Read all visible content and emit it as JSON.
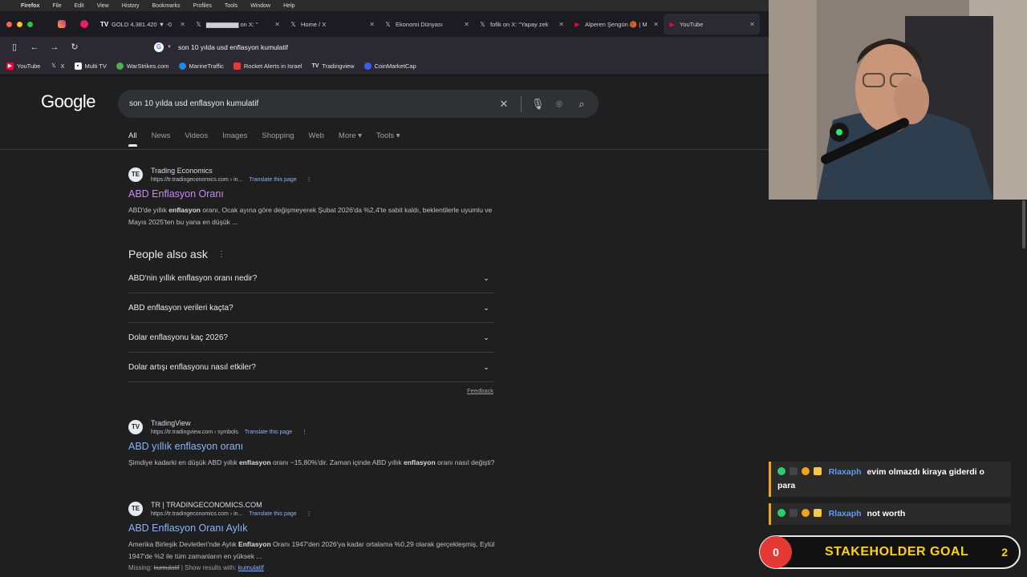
{
  "menubar": {
    "items": [
      "Firefox",
      "File",
      "Edit",
      "View",
      "History",
      "Bookmarks",
      "Profiles",
      "Tools",
      "Window",
      "Help"
    ]
  },
  "tabs": [
    {
      "label": "GOLD 4,381.420 ▼ -0",
      "icon": "tradingview-icon"
    },
    {
      "label": "▆▆▆▆▆▆▆ on X: \"",
      "icon": "x-icon"
    },
    {
      "label": "Home / X",
      "icon": "x-icon"
    },
    {
      "label": "Ekonomi Dünyası",
      "icon": "x-icon"
    },
    {
      "label": "fofik on X: \"Yapay zek",
      "icon": "x-icon"
    },
    {
      "label": "Alperen Şengün 🏀 | M",
      "icon": "youtube-icon"
    },
    {
      "label": "YouTube",
      "icon": "youtube-icon"
    }
  ],
  "address": {
    "url": "son 10 yılda usd enflasyon kumulatif"
  },
  "bookmarks": [
    {
      "label": "YouTube",
      "color": "#ff0033"
    },
    {
      "label": "X",
      "color": "#ffffff"
    },
    {
      "label": "Multi TV",
      "color": "#ffffff"
    },
    {
      "label": "WarStrikes.com",
      "color": "#4caf50"
    },
    {
      "label": "MarineTraffic",
      "color": "#1e88e5"
    },
    {
      "label": "Rocket Alerts in Israel",
      "color": "#e53935"
    },
    {
      "label": "Tradingview",
      "color": "#ffffff"
    },
    {
      "label": "CoinMarketCap",
      "color": "#3861fb"
    }
  ],
  "google": {
    "logo": "Google",
    "query": "son 10 yılda usd enflasyon kumulatif",
    "tabs": [
      "All",
      "News",
      "Videos",
      "Images",
      "Shopping",
      "Web",
      "More ▾",
      "Tools ▾"
    ],
    "results": [
      {
        "site": "Trading Economics",
        "url": "https://tr.tradingeconomics.com › in...",
        "translate": "Translate this page",
        "title": "ABD Enflasyon Oranı",
        "snippet_html": "ABD'de yıllık <b>enflasyon</b> oranı, Ocak ayına göre değişmeyerek Şubat 2026'da %2,4'te sabit kaldı, beklentilerle uyumlu ve Mayıs 2025'ten bu yana en düşük ..."
      },
      {
        "site": "TradingView",
        "url": "https://tr.tradingview.com › symbols",
        "translate": "Translate this page",
        "title": "ABD yıllık enflasyon oranı",
        "snippet_html": "Şimdiye kadarki en düşük ABD yıllık <b>enflasyon</b> oranı −15,80%'dir. Zaman içinde ABD yıllık <b>enflasyon</b> oranı nasıl değişti?"
      },
      {
        "site": "TR | TRADINGECONOMICS.COM",
        "url": "https://tr.tradingeconomics.com › in...",
        "translate": "Translate this page",
        "title": "ABD Enflasyon Oranı Aylık",
        "snippet_html": "Amerika Birleşik Devletleri'nde Aylık <b>Enflasyon</b> Oranı 1947'den 2026'ya kadar ortalama %0,29 olarak gerçekleşmiş, Eylül 1947'de %2 ile tüm zamanların en yüksek ...",
        "missing_label": "Missing:",
        "missing_word": "kumulatif",
        "show_results": "Show results with:",
        "show_word": "kumulatif"
      }
    ],
    "paa": {
      "title": "People also ask",
      "questions": [
        "ABD'nin yıllık enflasyon oranı nedir?",
        "ABD enflasyon verileri kaçta?",
        "Dolar enflasyonu kaç 2026?",
        "Dolar artışı enflasyonu nasıl etkiler?"
      ],
      "feedback": "Feedback"
    }
  },
  "chat": [
    {
      "user": "Rlaxaph",
      "text": "evim olmazdı kiraya giderdi o para"
    },
    {
      "user": "Rlaxaph",
      "text": "not worth"
    }
  ],
  "goal": {
    "left": "0",
    "title": "STAKEHOLDER GOAL",
    "right": "2"
  }
}
